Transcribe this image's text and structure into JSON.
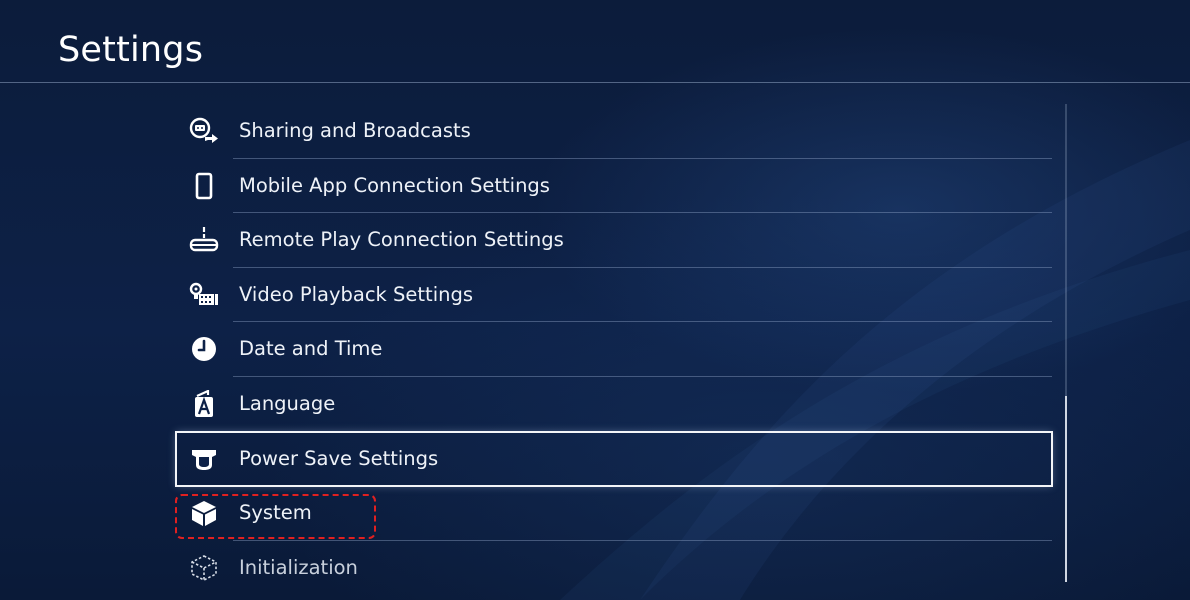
{
  "header": {
    "title": "Settings"
  },
  "menu": {
    "items": [
      {
        "label": "Sharing and Broadcasts",
        "icon": "sharing-broadcast-icon"
      },
      {
        "label": "Mobile App Connection Settings",
        "icon": "smartphone-icon"
      },
      {
        "label": "Remote Play Connection Settings",
        "icon": "remote-play-icon"
      },
      {
        "label": "Video Playback Settings",
        "icon": "video-playback-icon"
      },
      {
        "label": "Date and Time",
        "icon": "clock-icon"
      },
      {
        "label": "Language",
        "icon": "language-icon"
      },
      {
        "label": "Power Save Settings",
        "icon": "power-save-icon"
      },
      {
        "label": "System",
        "icon": "system-cube-icon"
      },
      {
        "label": "Initialization",
        "icon": "initialization-icon"
      }
    ],
    "selected_label": "Power Save Settings",
    "annotated_label": "System"
  },
  "colors": {
    "background": "#0d2147",
    "text": "#eef2f8",
    "annotation": "#e02020",
    "selection_outline": "#f3f5f8"
  }
}
